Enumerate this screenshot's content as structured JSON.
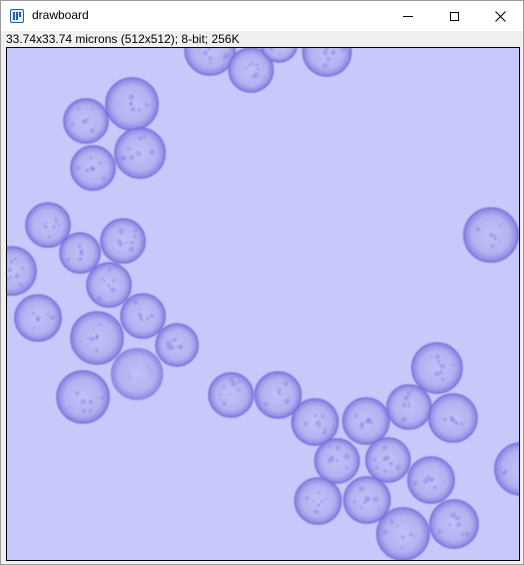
{
  "window": {
    "title": "drawboard",
    "app_icon": "imagej-icon",
    "buttons": {
      "minimize": "minimize-icon",
      "maximize": "maximize-icon",
      "close": "close-icon"
    }
  },
  "image_info": "33.74x33.74 microns (512x512); 8-bit; 256K",
  "colors": {
    "canvas_background": "#c8c8fb",
    "cell_fill": "#b8b6f4",
    "cell_border": "#6f6ad6",
    "cell_texture": "#8e89e6"
  }
}
